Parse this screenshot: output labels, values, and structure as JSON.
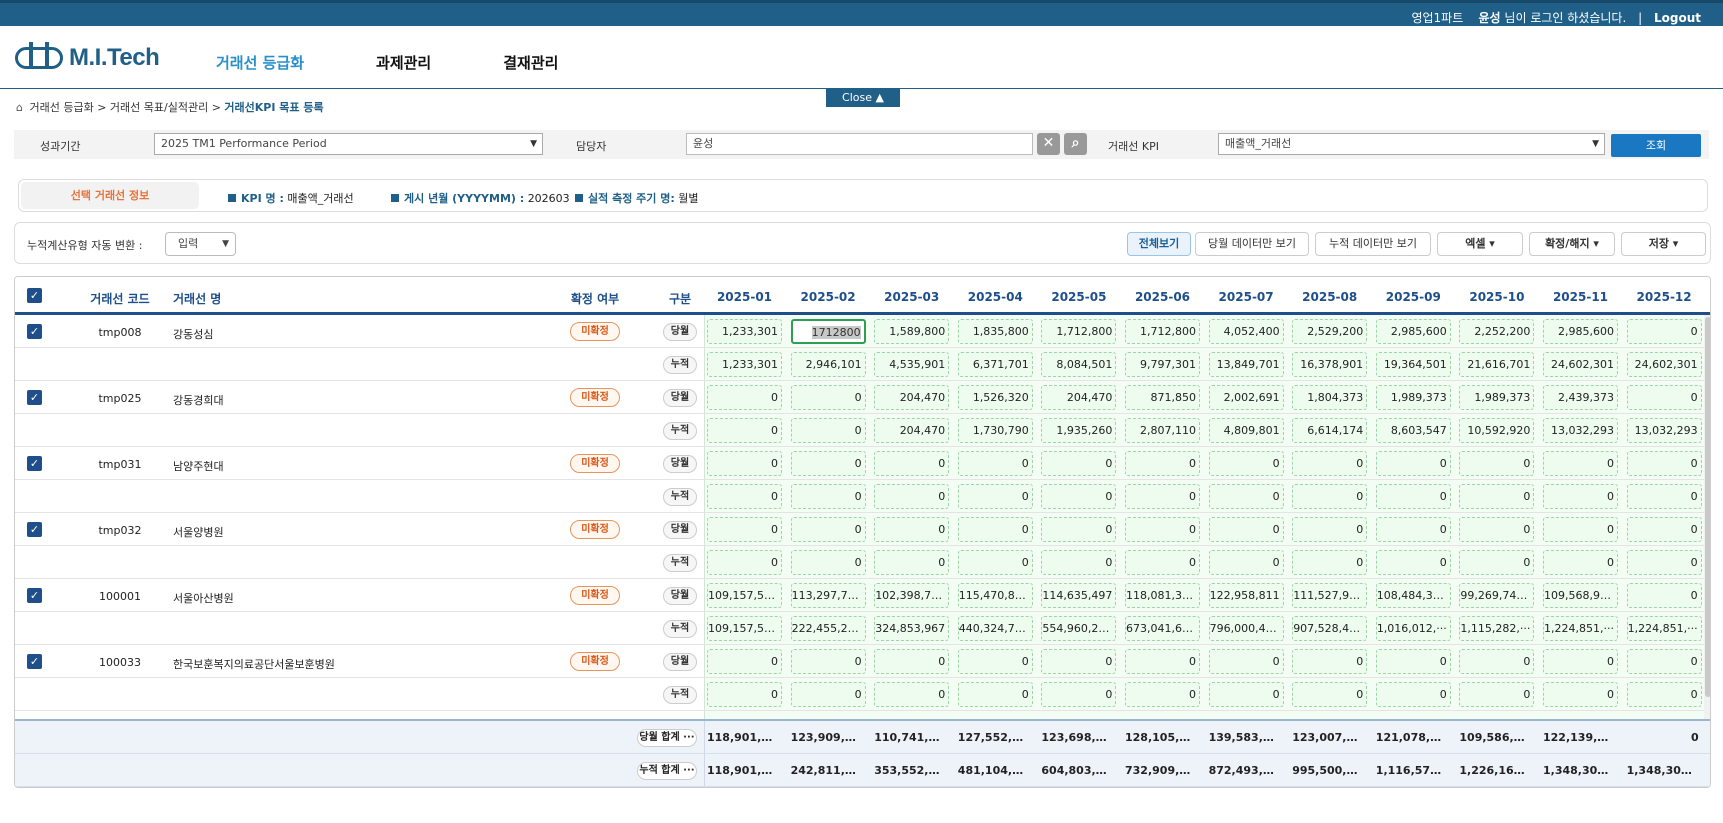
{
  "topbar": {
    "dept": "영업1파트",
    "user": "윤성",
    "login_msg": "님이 로그인 하셨습니다.",
    "sep": "|",
    "logout": "Logout"
  },
  "logo": {
    "text": "M.I.Tech"
  },
  "nav": [
    "거래선 등급화",
    "과제관리",
    "결재관리"
  ],
  "close_label": "Close ▲",
  "breadcrumb": {
    "a": "거래선 등급화 > 거래선 목표/실적관리 > ",
    "current": "거래선KPI 목표 등록"
  },
  "filter": {
    "period_label": "성과기간",
    "period_value": "2025 TM1 Performance Period",
    "owner_label": "담당자",
    "owner_value": "윤성",
    "kpi_label": "거래선 KPI",
    "kpi_value": "매출액_거래선",
    "search_label": "조회"
  },
  "info": {
    "tab": "선택 거래선 정보",
    "kpi_key": "KPI 명 :",
    "kpi_val": "매출액_거래선",
    "ym_key": "게시 년월 (YYYYMM) :",
    "ym_val": "202603",
    "cycle_key": "실적 측정 주기 명:",
    "cycle_val": "월별"
  },
  "toolbar": {
    "auto_label": "누적계산유형 자동 변환 :",
    "auto_value": "입력",
    "buttons": [
      "전체보기",
      "당월 데이터만 보기",
      "누적 데이터만 보기",
      "엑셀 ▾",
      "확정/해지 ▾",
      "저장 ▾"
    ]
  },
  "grid": {
    "headers": {
      "code": "거래선 코드",
      "name": "거래선 명",
      "status": "확정 여부",
      "type": "구분"
    },
    "months": [
      "2025-01",
      "2025-02",
      "2025-03",
      "2025-04",
      "2025-05",
      "2025-06",
      "2025-07",
      "2025-08",
      "2025-09",
      "2025-10",
      "2025-11",
      "2025-12"
    ],
    "rows": [
      {
        "check": true,
        "code": "tmp008",
        "name": "강동성심",
        "status": "미확정",
        "monthly_label": "당월",
        "cumulative_label": "누적",
        "monthly": [
          "1,233,301",
          "1712800",
          "1,589,800",
          "1,835,800",
          "1,712,800",
          "1,712,800",
          "4,052,400",
          "2,529,200",
          "2,985,600",
          "2,252,200",
          "2,985,600",
          "0"
        ],
        "cumulative": [
          "1,233,301",
          "2,946,101",
          "4,535,901",
          "6,371,701",
          "8,084,501",
          "9,797,301",
          "13,849,701",
          "16,378,901",
          "19,364,501",
          "21,616,701",
          "24,602,301",
          "24,602,301"
        ]
      },
      {
        "check": true,
        "code": "tmp025",
        "name": "강동경희대",
        "status": "미확정",
        "monthly_label": "당월",
        "cumulative_label": "누적",
        "monthly": [
          "0",
          "0",
          "204,470",
          "1,526,320",
          "204,470",
          "871,850",
          "2,002,691",
          "1,804,373",
          "1,989,373",
          "1,989,373",
          "2,439,373",
          "0"
        ],
        "cumulative": [
          "0",
          "0",
          "204,470",
          "1,730,790",
          "1,935,260",
          "2,807,110",
          "4,809,801",
          "6,614,174",
          "8,603,547",
          "10,592,920",
          "13,032,293",
          "13,032,293"
        ]
      },
      {
        "check": true,
        "code": "tmp031",
        "name": "남양주현대",
        "status": "미확정",
        "monthly_label": "당월",
        "cumulative_label": "누적",
        "monthly": [
          "0",
          "0",
          "0",
          "0",
          "0",
          "0",
          "0",
          "0",
          "0",
          "0",
          "0",
          "0"
        ],
        "cumulative": [
          "0",
          "0",
          "0",
          "0",
          "0",
          "0",
          "0",
          "0",
          "0",
          "0",
          "0",
          "0"
        ]
      },
      {
        "check": true,
        "code": "tmp032",
        "name": "서울양병원",
        "status": "미확정",
        "monthly_label": "당월",
        "cumulative_label": "누적",
        "monthly": [
          "0",
          "0",
          "0",
          "0",
          "0",
          "0",
          "0",
          "0",
          "0",
          "0",
          "0",
          "0"
        ],
        "cumulative": [
          "0",
          "0",
          "0",
          "0",
          "0",
          "0",
          "0",
          "0",
          "0",
          "0",
          "0",
          "0"
        ]
      },
      {
        "check": true,
        "code": "100001",
        "name": "서울아산병원",
        "status": "미확정",
        "monthly_label": "당월",
        "cumulative_label": "누적",
        "monthly": [
          "109,157,52···",
          "113,297,72···",
          "102,398,71···",
          "115,470,81···",
          "114,635,497",
          "118,081,35···",
          "122,958,811",
          "111,527,98···",
          "108,484,34···",
          "99,269,748.7",
          "109,568,95···",
          "0"
        ],
        "cumulative": [
          "109,157,52···",
          "222,455,25···",
          "324,853,967",
          "440,324,78···",
          "554,960,28···",
          "673,041,63···",
          "796,000,44···",
          "907,528,42···",
          "1,016,012,···",
          "1,115,282,···",
          "1,224,851,···",
          "1,224,851,···"
        ]
      },
      {
        "check": true,
        "code": "100033",
        "name": "한국보훈복지의료공단서울보훈병원",
        "status": "미확정",
        "monthly_label": "당월",
        "cumulative_label": "누적",
        "monthly": [
          "0",
          "0",
          "0",
          "0",
          "0",
          "0",
          "0",
          "0",
          "0",
          "0",
          "0",
          "0"
        ],
        "cumulative": [
          "0",
          "0",
          "0",
          "0",
          "0",
          "0",
          "0",
          "0",
          "0",
          "0",
          "0",
          "0"
        ]
      }
    ],
    "totals": [
      {
        "label": "당월 합계 ···",
        "values": [
          "118,901,3···",
          "123,909,6···",
          "110,741,6···",
          "127,552,1···",
          "123,698,7···",
          "128,105,6···",
          "139,583,7···",
          "123,007,5···",
          "121,078,8···",
          "109,586,4···",
          "122,139,9···",
          "0"
        ]
      },
      {
        "label": "누적 합계 ···",
        "values": [
          "118,901,3···",
          "242,811,0···",
          "353,552,6···",
          "481,104,8···",
          "604,803,6···",
          "732,909,3···",
          "872,493,0···",
          "995,500,6···",
          "1,116,579···",
          "1,226,165···",
          "1,348,305···",
          "1,348,305···"
        ]
      }
    ]
  },
  "colors": {
    "brand": "#1f5f88",
    "accent_orange": "#e8733a",
    "cell_green": "#eefcef",
    "button_blue": "#1a78c2"
  }
}
